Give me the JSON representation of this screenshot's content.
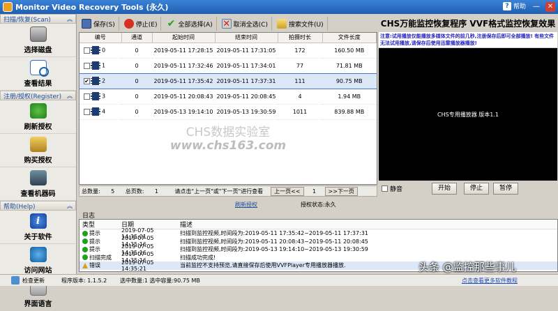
{
  "window": {
    "title": "Monitor Video Recovery Tools (永久)",
    "help_label": "帮助",
    "minimize_glyph": "—",
    "close_glyph": "✕"
  },
  "sidebar": {
    "section_scan": "扫描/恢复(Scan)",
    "section_register": "注册/授权(Register)",
    "section_help": "帮助(Help)",
    "items": [
      {
        "label": "选择磁盘",
        "icon": "disk-icon"
      },
      {
        "label": "查看结果",
        "icon": "view-results-icon"
      },
      {
        "label": "刷新授权",
        "icon": "refresh-icon"
      },
      {
        "label": "购买授权",
        "icon": "purchase-icon"
      },
      {
        "label": "查看机器码",
        "icon": "machine-code-icon"
      },
      {
        "label": "关于软件",
        "icon": "info-icon"
      },
      {
        "label": "访问网站",
        "icon": "globe-icon"
      },
      {
        "label": "界面语言",
        "icon": "language-icon"
      }
    ]
  },
  "toolbar": {
    "save": "保存(S)",
    "stop": "停止(E)",
    "select_all": "全部选择(A)",
    "deselect_all": "取消全选(C)",
    "search_file": "搜索文件(U)"
  },
  "banner": "CHS万能监控恢复程序 VVF格式监控恢复效果",
  "table": {
    "headers": [
      "编号",
      "通道",
      "起始时间",
      "结束时间",
      "拍摄时长",
      "文件长度"
    ],
    "rows": [
      {
        "id": "0",
        "channel": "0",
        "start": "2019-05-11 17:28:15",
        "end": "2019-05-11 17:31:05",
        "duration": "172",
        "size": "160.50 MB",
        "checked": "",
        "selected": false
      },
      {
        "id": "1",
        "channel": "0",
        "start": "2019-05-11 17:32:46",
        "end": "2019-05-11 17:34:01",
        "duration": "77",
        "size": "71.81 MB",
        "checked": "",
        "selected": false
      },
      {
        "id": "2",
        "channel": "0",
        "start": "2019-05-11 17:35:42",
        "end": "2019-05-11 17:37:31",
        "duration": "111",
        "size": "90.75 MB",
        "checked": "✔",
        "selected": true
      },
      {
        "id": "3",
        "channel": "0",
        "start": "2019-05-11 20:08:43",
        "end": "2019-05-11 20:08:45",
        "duration": "4",
        "size": "1.94 MB",
        "checked": "",
        "selected": false
      },
      {
        "id": "4",
        "channel": "0",
        "start": "2019-05-13 19:14:10",
        "end": "2019-05-13 19:30:59",
        "duration": "1011",
        "size": "839.88 MB",
        "checked": "",
        "selected": false
      }
    ]
  },
  "watermark": {
    "line1": "CHS数据实验室",
    "line2": "www.chs163.com"
  },
  "pager": {
    "total_label": "总数量:",
    "total_value": "5",
    "pages_label": "总页数:",
    "pages_value": "1",
    "hint": "请点击\"上一页\"或\"下一页\"进行查看",
    "prev": "上一页<<",
    "current_page": "1",
    "next": ">>下一页"
  },
  "status": {
    "refresh_link": "刷新授权",
    "auth_status": "授权状态:永久"
  },
  "player": {
    "notice": "注意:试用播放仅能播放多媒体文件的前几秒,注册保存后即可全部播放! 有些文件无法试用播放,请保存后使用迅雷播放器播放!",
    "screen_text": "CHS专用播放器 版本1.1",
    "mute_label": "静音",
    "play": "开始",
    "stop": "停止",
    "pause": "暂停"
  },
  "log": {
    "title": "日志",
    "headers": {
      "type": "类型",
      "time": "日期",
      "desc": "描述"
    },
    "rows": [
      {
        "type": "提示",
        "kind": "ok",
        "time": "2019-07-05 14:35:01",
        "desc": "扫描到监控视频,时间段为:2019-05-11 17:35:42~2019-05-11 17:37:31"
      },
      {
        "type": "提示",
        "kind": "ok",
        "time": "2019-07-05 14:35:16",
        "desc": "扫描到监控视频,时间段为:2019-05-11 20:08:43~2019-05-11 20:08:45"
      },
      {
        "type": "提示",
        "kind": "ok",
        "time": "2019-07-05 14:35:16",
        "desc": "扫描到监控视频,时间段为:2019-05-13 19:14:10~2019-05-13 19:30:59"
      },
      {
        "type": "扫描完成",
        "kind": "ok",
        "time": "2019-07-05 14:35:16",
        "desc": "扫描成功完成!"
      },
      {
        "type": "错误",
        "kind": "warn",
        "time": "2019-07-05 14:35:21",
        "desc": "当前监控不支持预览,请直接保存后使用VVFPlayer专用播放器播放."
      }
    ]
  },
  "bottom": {
    "check_update": "检查更新",
    "version_label": "程序版本:",
    "version": "1.1.5.2",
    "selection": "选中数量:1 选中容量:90.75 MB",
    "link": "点击查看更多软件教程"
  },
  "overlay_text": "头条 @监控那些事儿"
}
